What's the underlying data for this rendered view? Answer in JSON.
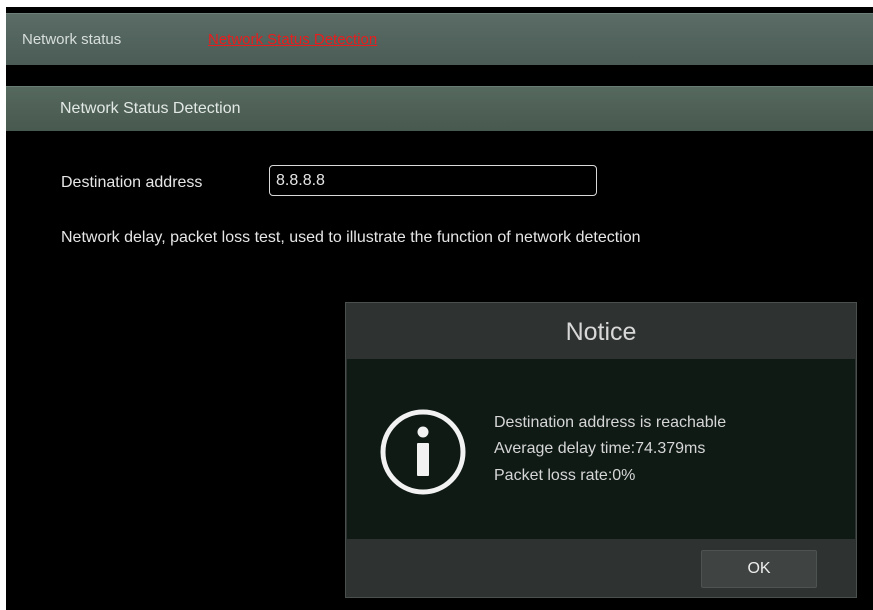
{
  "tabs": [
    {
      "label": "Network status",
      "active": false
    },
    {
      "label": "Network Status Detection",
      "active": true
    }
  ],
  "section": {
    "title": "Network Status Detection"
  },
  "form": {
    "destination_label": "Destination address",
    "destination_value": "8.8.8.8",
    "description": "Network delay, packet loss test, used to illustrate the function of network detection"
  },
  "dialog": {
    "title": "Notice",
    "icon": "info-icon",
    "lines": [
      "Destination address is reachable",
      "Average delay time:74.379ms",
      "Packet loss rate:0%"
    ],
    "ok_label": "OK"
  },
  "colors": {
    "active_tab": "#e81d1d",
    "header_bar": "#4f6159",
    "dialog_body": "#0f1a15"
  }
}
